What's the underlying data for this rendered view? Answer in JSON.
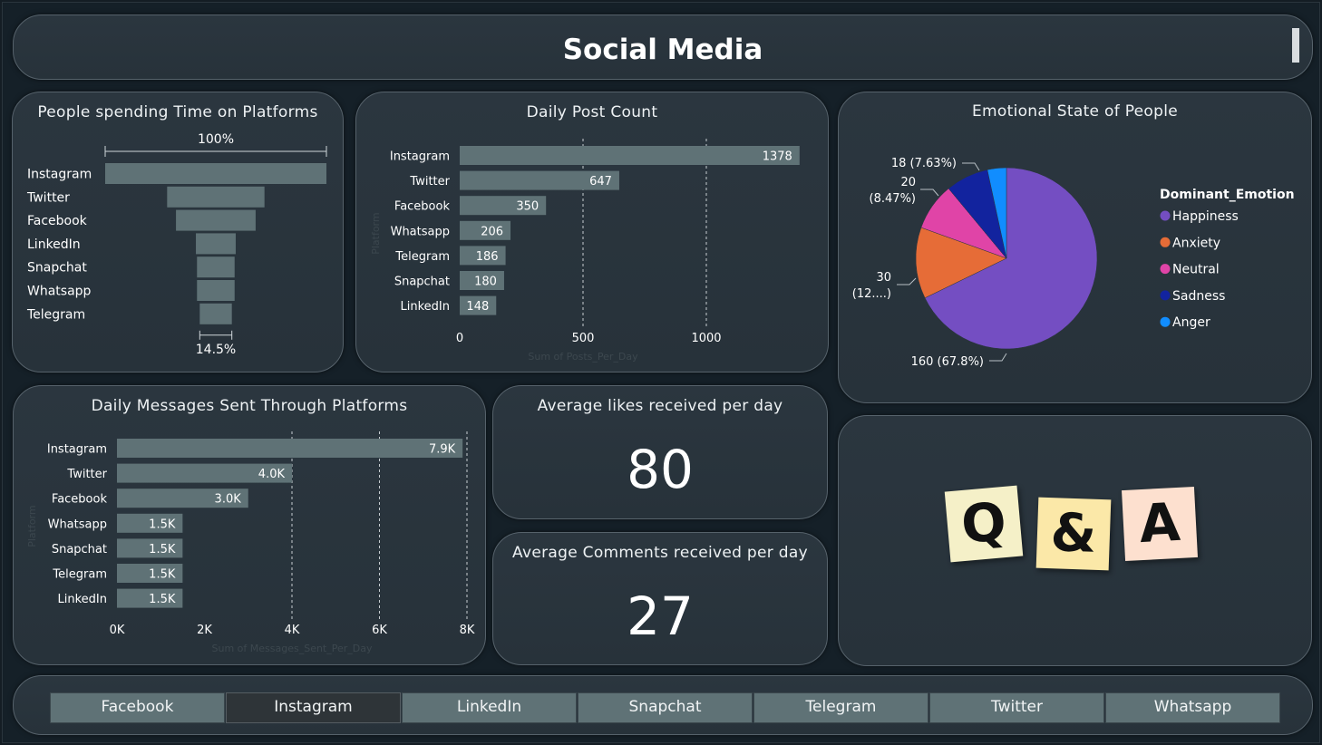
{
  "header": {
    "title": "Social Media"
  },
  "funnel": {
    "title": "People spending Time on Platforms",
    "top_pct": "100%",
    "bottom_pct": "14.5%",
    "items": [
      {
        "label": "Instagram",
        "value": 100
      },
      {
        "label": "Twitter",
        "value": 44
      },
      {
        "label": "Facebook",
        "value": 36
      },
      {
        "label": "LinkedIn",
        "value": 18
      },
      {
        "label": "Snapchat",
        "value": 17
      },
      {
        "label": "Whatsapp",
        "value": 17
      },
      {
        "label": "Telegram",
        "value": 14.5
      }
    ]
  },
  "posts": {
    "title": "Daily Post Count",
    "axis_y": "Platform",
    "axis_x": "Sum of Posts_Per_Day",
    "ticks": [
      "0",
      "500",
      "1000"
    ],
    "categories": [
      "Instagram",
      "Twitter",
      "Facebook",
      "Whatsapp",
      "Telegram",
      "Snapchat",
      "LinkedIn"
    ],
    "values": [
      1378,
      647,
      350,
      206,
      186,
      180,
      148
    ],
    "labels": [
      "1378",
      "647",
      "350",
      "206",
      "186",
      "180",
      "148"
    ]
  },
  "emotions": {
    "title": "Emotional State of People",
    "legend_title": "Dominant_Emotion",
    "slices": [
      {
        "name": "Happiness",
        "value": 160,
        "color": "#744ec2"
      },
      {
        "name": "Anxiety",
        "value": 30,
        "color": "#e66c37"
      },
      {
        "name": "Neutral",
        "value": 20,
        "color": "#e044a7"
      },
      {
        "name": "Sadness",
        "value": 18,
        "color": "#12239e"
      },
      {
        "name": "Anger",
        "value": 8,
        "color": "#118dff"
      }
    ],
    "labels": {
      "happiness": "160 (67.8%)",
      "anxiety_value": "30",
      "anxiety_pct": "(12....)",
      "neutral_value": "20",
      "neutral_pct": "(8.47%)",
      "sadness": "18 (7.63%)"
    }
  },
  "messages": {
    "title": "Daily Messages Sent Through Platforms",
    "axis_y": "Platform",
    "axis_x": "Sum of Messages_Sent_Per_Day",
    "ticks": [
      "0K",
      "2K",
      "4K",
      "6K",
      "8K"
    ],
    "categories": [
      "Instagram",
      "Twitter",
      "Facebook",
      "Whatsapp",
      "Snapchat",
      "Telegram",
      "LinkedIn"
    ],
    "values": [
      7900,
      4000,
      3000,
      1500,
      1500,
      1500,
      1500
    ],
    "labels": [
      "7.9K",
      "4.0K",
      "3.0K",
      "1.5K",
      "1.5K",
      "1.5K",
      "1.5K"
    ]
  },
  "kpi_likes": {
    "title": "Average likes received per day",
    "value": "80"
  },
  "kpi_comments": {
    "title": "Average Comments received per day",
    "value": "27"
  },
  "qa": {
    "q": "Q",
    "amp": "&",
    "a": "A"
  },
  "slicer": {
    "items": [
      "Facebook",
      "Instagram",
      "LinkedIn",
      "Snapchat",
      "Telegram",
      "Twitter",
      "Whatsapp"
    ],
    "selected": "Instagram"
  },
  "colors": {
    "bar": "#5f7276",
    "card_border": "#56626b",
    "background": "#141d24"
  }
}
